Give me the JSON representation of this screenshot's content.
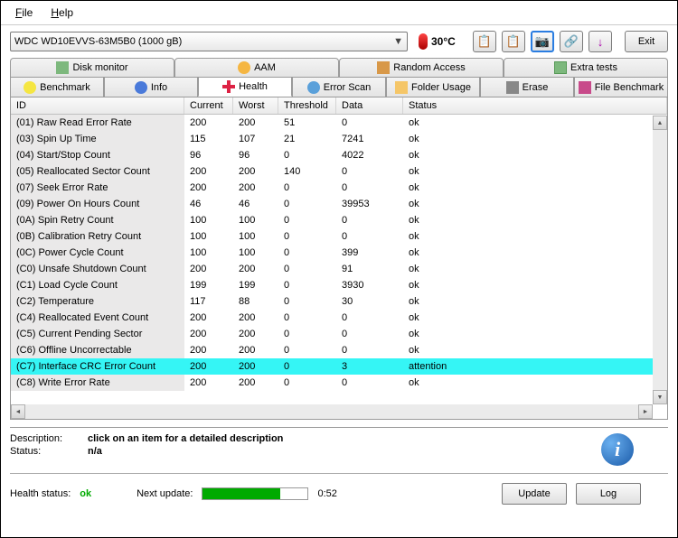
{
  "menu": {
    "file": "File",
    "help": "Help"
  },
  "drive": "WDC WD10EVVS-63M5B0 (1000 gB)",
  "temp": "30°C",
  "exit": "Exit",
  "tabs": {
    "monitor": "Disk monitor",
    "aam": "AAM",
    "random": "Random Access",
    "extra": "Extra tests",
    "benchmark": "Benchmark",
    "info": "Info",
    "health": "Health",
    "errorscan": "Error Scan",
    "folder": "Folder Usage",
    "erase": "Erase",
    "filebench": "File Benchmark"
  },
  "columns": {
    "id": "ID",
    "current": "Current",
    "worst": "Worst",
    "threshold": "Threshold",
    "data": "Data",
    "status": "Status"
  },
  "rows": [
    {
      "id": "(01) Raw Read Error Rate",
      "cur": "200",
      "wor": "200",
      "thr": "51",
      "dat": "0",
      "sta": "ok",
      "hl": false
    },
    {
      "id": "(03) Spin Up Time",
      "cur": "115",
      "wor": "107",
      "thr": "21",
      "dat": "7241",
      "sta": "ok",
      "hl": false
    },
    {
      "id": "(04) Start/Stop Count",
      "cur": "96",
      "wor": "96",
      "thr": "0",
      "dat": "4022",
      "sta": "ok",
      "hl": false
    },
    {
      "id": "(05) Reallocated Sector Count",
      "cur": "200",
      "wor": "200",
      "thr": "140",
      "dat": "0",
      "sta": "ok",
      "hl": false
    },
    {
      "id": "(07) Seek Error Rate",
      "cur": "200",
      "wor": "200",
      "thr": "0",
      "dat": "0",
      "sta": "ok",
      "hl": false
    },
    {
      "id": "(09) Power On Hours Count",
      "cur": "46",
      "wor": "46",
      "thr": "0",
      "dat": "39953",
      "sta": "ok",
      "hl": false
    },
    {
      "id": "(0A) Spin Retry Count",
      "cur": "100",
      "wor": "100",
      "thr": "0",
      "dat": "0",
      "sta": "ok",
      "hl": false
    },
    {
      "id": "(0B) Calibration Retry Count",
      "cur": "100",
      "wor": "100",
      "thr": "0",
      "dat": "0",
      "sta": "ok",
      "hl": false
    },
    {
      "id": "(0C) Power Cycle Count",
      "cur": "100",
      "wor": "100",
      "thr": "0",
      "dat": "399",
      "sta": "ok",
      "hl": false
    },
    {
      "id": "(C0) Unsafe Shutdown Count",
      "cur": "200",
      "wor": "200",
      "thr": "0",
      "dat": "91",
      "sta": "ok",
      "hl": false
    },
    {
      "id": "(C1) Load Cycle Count",
      "cur": "199",
      "wor": "199",
      "thr": "0",
      "dat": "3930",
      "sta": "ok",
      "hl": false
    },
    {
      "id": "(C2) Temperature",
      "cur": "117",
      "wor": "88",
      "thr": "0",
      "dat": "30",
      "sta": "ok",
      "hl": false
    },
    {
      "id": "(C4) Reallocated Event Count",
      "cur": "200",
      "wor": "200",
      "thr": "0",
      "dat": "0",
      "sta": "ok",
      "hl": false
    },
    {
      "id": "(C5) Current Pending Sector",
      "cur": "200",
      "wor": "200",
      "thr": "0",
      "dat": "0",
      "sta": "ok",
      "hl": false
    },
    {
      "id": "(C6) Offline Uncorrectable",
      "cur": "200",
      "wor": "200",
      "thr": "0",
      "dat": "0",
      "sta": "ok",
      "hl": false
    },
    {
      "id": "(C7) Interface CRC Error Count",
      "cur": "200",
      "wor": "200",
      "thr": "0",
      "dat": "3",
      "sta": "attention",
      "hl": true
    },
    {
      "id": "(C8) Write Error Rate",
      "cur": "200",
      "wor": "200",
      "thr": "0",
      "dat": "0",
      "sta": "ok",
      "hl": false
    }
  ],
  "desc": {
    "description_label": "Description:",
    "description_value": "click on an item for a detailed description",
    "status_label": "Status:",
    "status_value": "n/a"
  },
  "footer": {
    "health_label": "Health status:",
    "health_value": "ok",
    "next_label": "Next update:",
    "next_time": "0:52",
    "update": "Update",
    "log": "Log"
  }
}
